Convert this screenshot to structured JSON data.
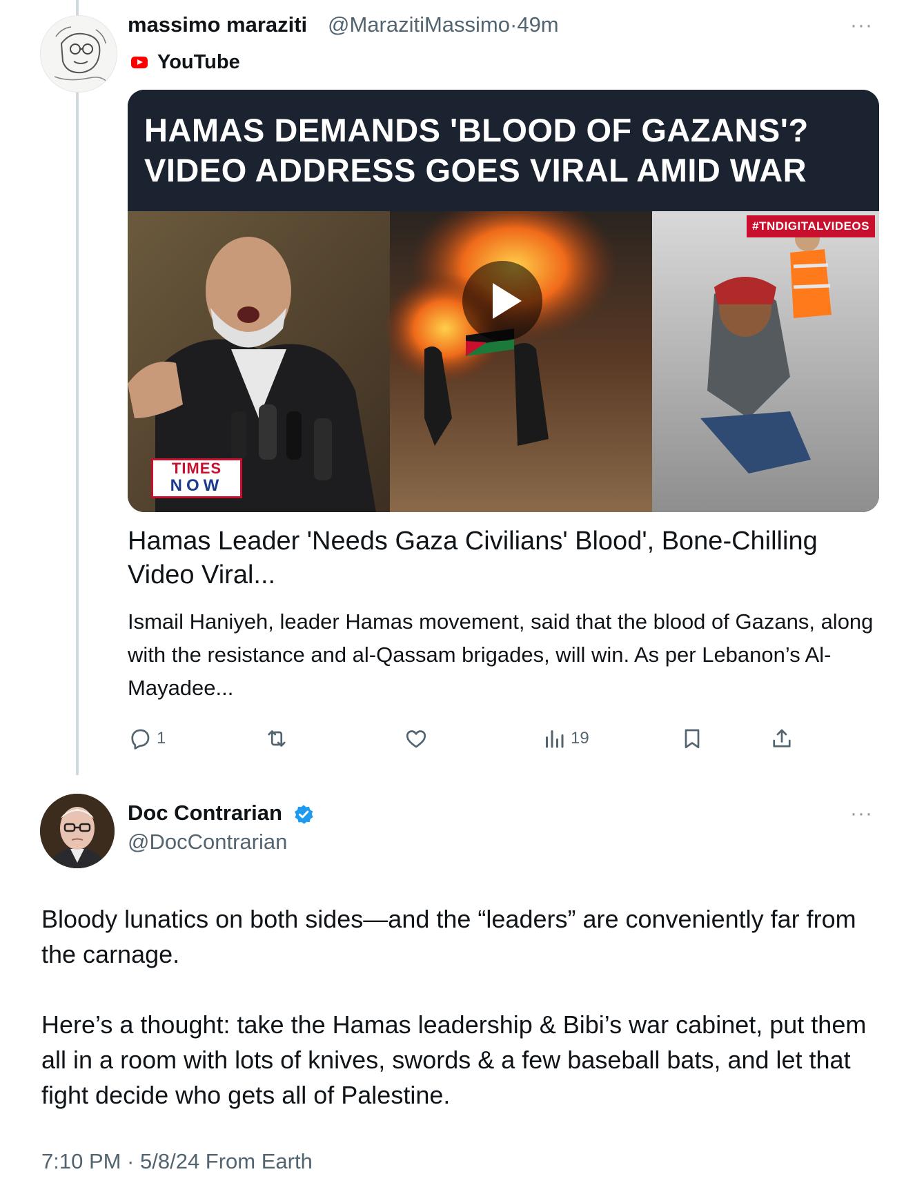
{
  "first_tweet": {
    "author_name": "massimo maraziti",
    "author_handle": "@MarazitiMassimo",
    "separator": "·",
    "age": "49m",
    "source_label": "YouTube",
    "more_label": "···",
    "thumbnail": {
      "headline_line1": "HAMAS DEMANDS 'BLOOD OF GAZANS'?",
      "headline_line2": "VIDEO ADDRESS GOES VIRAL AMID WAR",
      "tag": "#TNDIGITALVIDEOS",
      "logo_top": "TIMES",
      "logo_bottom": "NOW"
    },
    "card_title": "Hamas Leader 'Needs Gaza Civilians' Blood', Bone-Chilling Video Viral...",
    "card_description": "Ismail Haniyeh, leader Hamas movement, said that the blood of Gazans, along with the resistance and al-Qassam brigades, will win. As per Lebanon’s Al-Mayadee...",
    "actions": {
      "reply_count": "1",
      "views_count": "19"
    }
  },
  "second_tweet": {
    "author_name": "Doc Contrarian",
    "author_handle": "@DocContrarian",
    "more_label": "···",
    "paragraph1": "Bloody lunatics on both sides—and the “leaders” are conveniently far from the carnage.",
    "paragraph2": "Here’s a thought: take the Hamas leadership & Bibi’s war cabinet, put them all in a room with lots of knives, swords & a few baseball bats, and let that fight decide who gets all of Palestine.",
    "timestamp": "7:10 PM · 5/8/24 From Earth"
  },
  "colors": {
    "text": "#0f1419",
    "secondary": "#536471",
    "verified": "#1d9bf0",
    "youtube": "#ff0000",
    "thread_line": "#cfd9de"
  },
  "icons": [
    "reply-icon",
    "retweet-icon",
    "like-icon",
    "views-icon",
    "bookmark-icon",
    "share-icon",
    "verified-badge-icon",
    "youtube-icon",
    "more-icon",
    "play-icon"
  ]
}
